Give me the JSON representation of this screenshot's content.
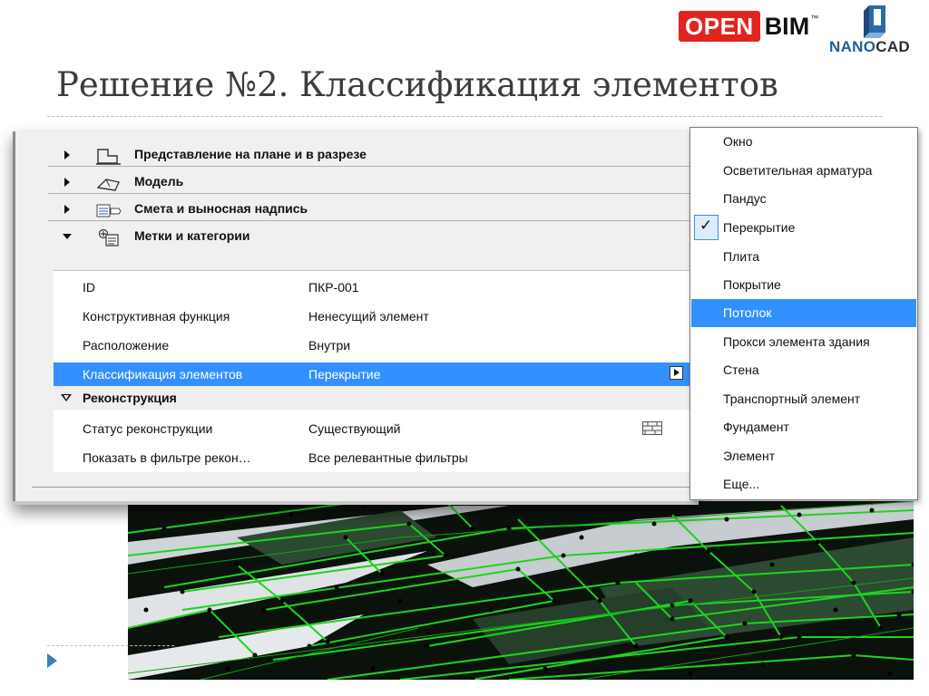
{
  "slide": {
    "title": "Решение №2. Классификация элементов"
  },
  "logos": {
    "openbim_open": "OPEN",
    "openbim_bim": "BIM",
    "openbim_tm": "™",
    "nanocad_nano": "NANO",
    "nanocad_cad": "CAD"
  },
  "panel": {
    "sections": [
      {
        "label": "Представление на плане и в разрезе",
        "expanded": false,
        "icon": "plan-section-icon"
      },
      {
        "label": "Модель",
        "expanded": false,
        "icon": "model-icon"
      },
      {
        "label": "Смета и выносная надпись",
        "expanded": false,
        "icon": "estimate-label-icon"
      },
      {
        "label": "Метки и категории",
        "expanded": true,
        "icon": "tags-categories-icon"
      }
    ],
    "properties": [
      {
        "key": "ID",
        "value": "ПКР-001"
      },
      {
        "key": "Конструктивная функция",
        "value": "Ненесущий элемент"
      },
      {
        "key": "Расположение",
        "value": "Внутри"
      },
      {
        "key": "Классификация элементов",
        "value": "Перекрытие",
        "selected": true
      }
    ],
    "group": {
      "label": "Реконструкция"
    },
    "renovation": [
      {
        "key": "Статус реконструкции",
        "value": "Существующий",
        "icon": "brick-wall-icon"
      },
      {
        "key": "Показать в фильтре рекон…",
        "value": "Все релевантные фильтры"
      }
    ]
  },
  "menu": {
    "items": [
      {
        "label": "Окно"
      },
      {
        "label": "Осветительная арматура"
      },
      {
        "label": "Пандус"
      },
      {
        "label": "Перекрытие",
        "checked": true
      },
      {
        "label": "Плита"
      },
      {
        "label": "Покрытие"
      },
      {
        "label": "Потолок",
        "highlighted": true
      },
      {
        "label": "Прокси элемента здания"
      },
      {
        "label": "Стена"
      },
      {
        "label": "Транспортный элемент"
      },
      {
        "label": "Фундамент"
      },
      {
        "label": "Элемент"
      },
      {
        "label": "Еще..."
      }
    ],
    "check_glyph": "✓"
  },
  "colors": {
    "selection": "#3390ff",
    "open_red": "#e2241f",
    "nanocad_blue": "#1f5f9a",
    "wireframe_green": "#1ed41e"
  }
}
